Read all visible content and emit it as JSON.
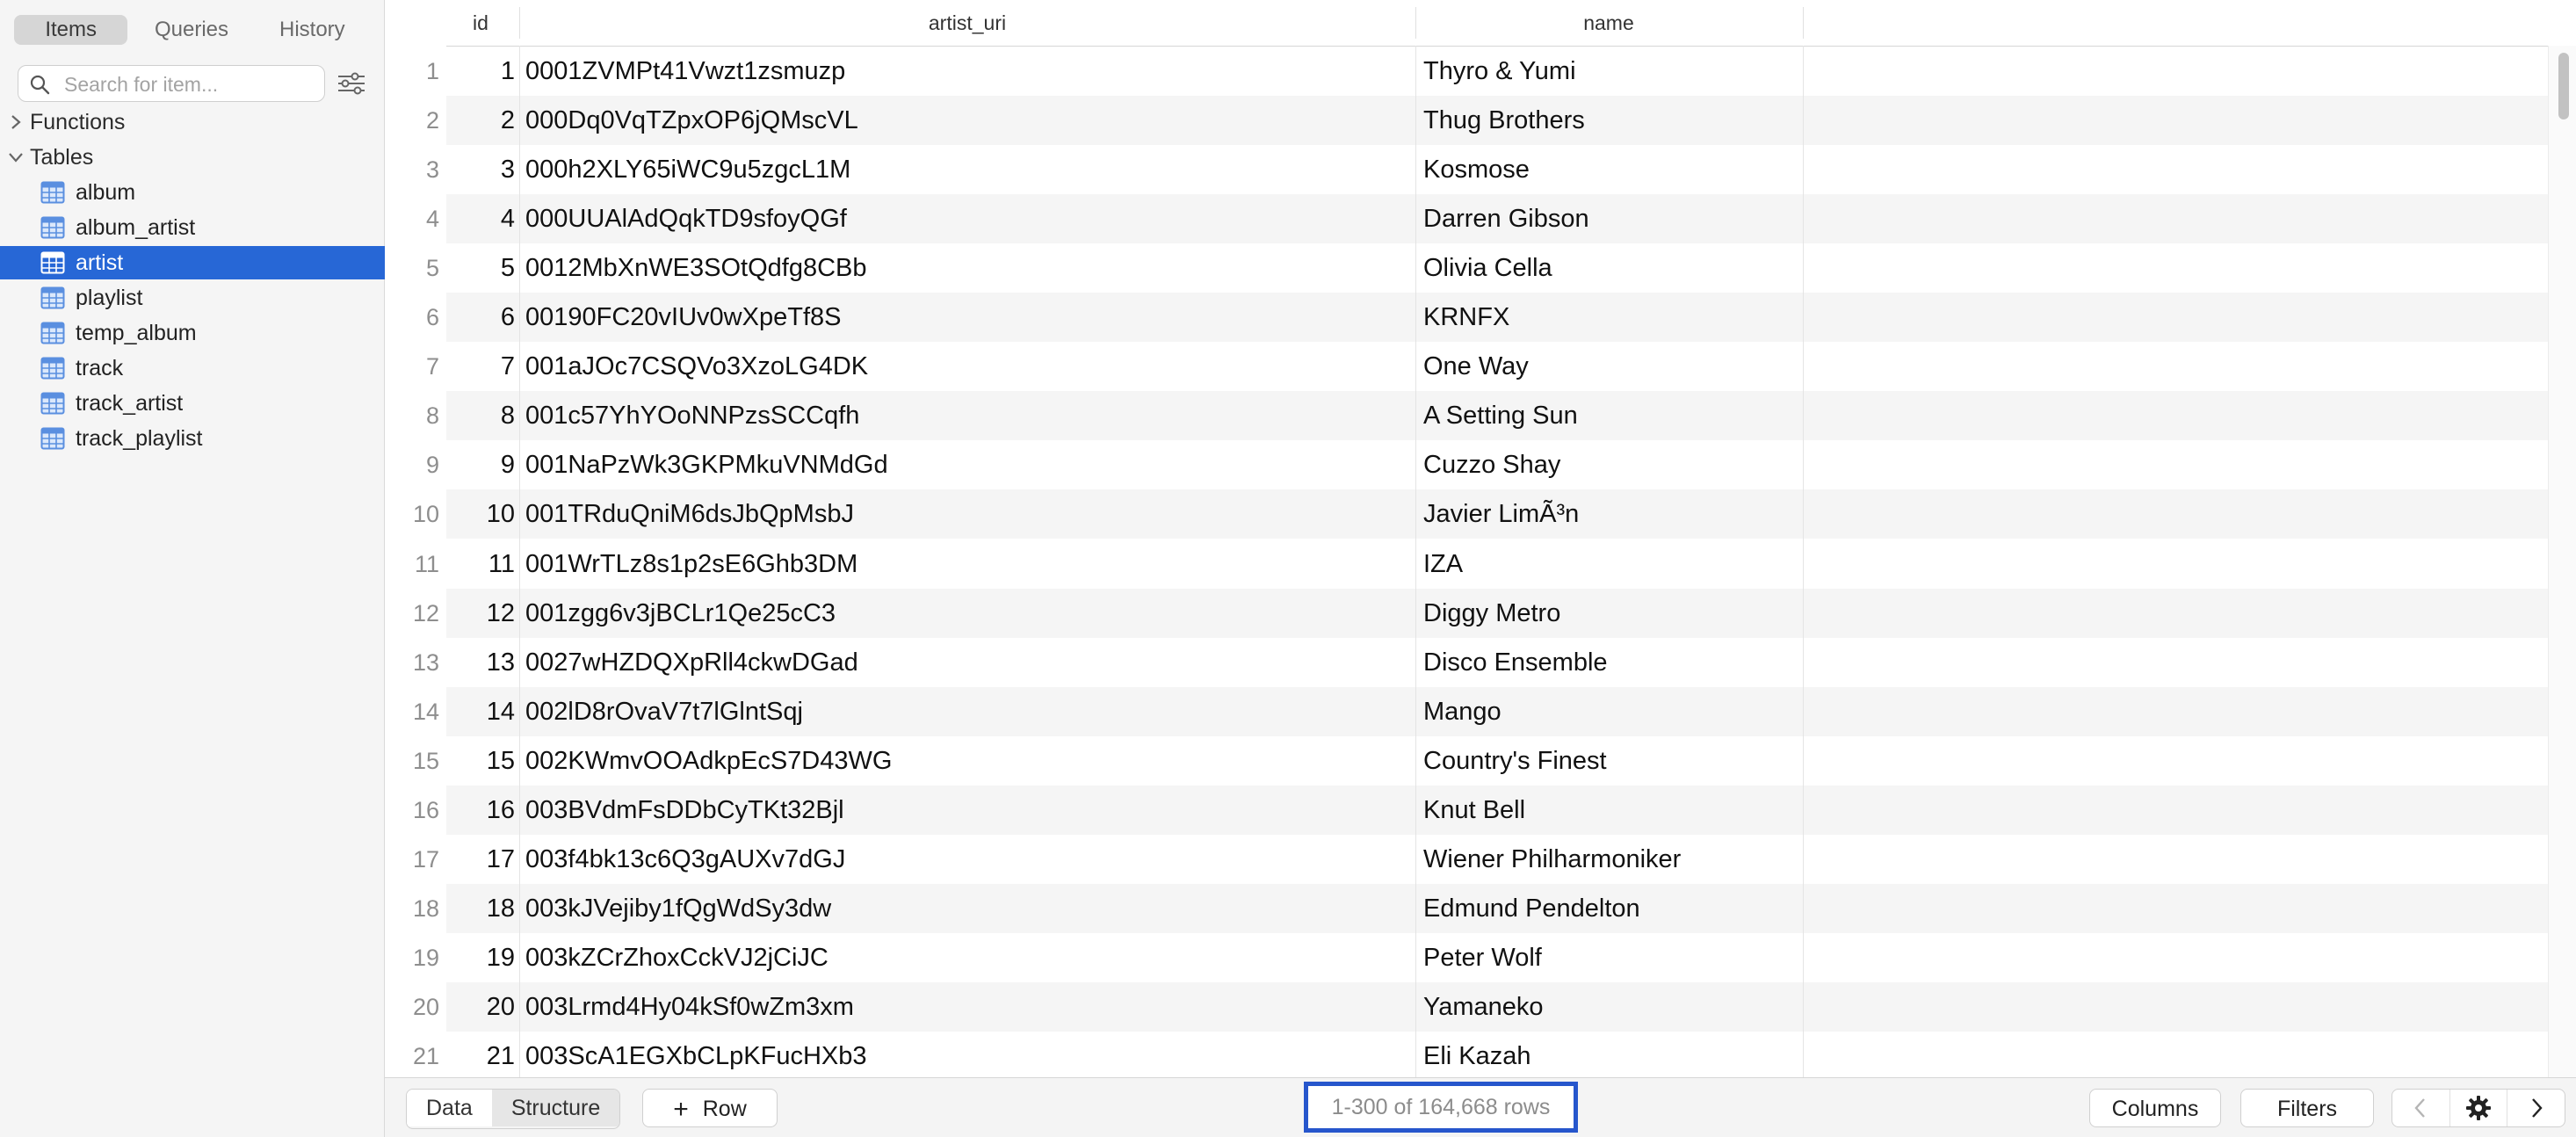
{
  "sidebar": {
    "tabs": [
      {
        "label": "Items",
        "active": true
      },
      {
        "label": "Queries",
        "active": false
      },
      {
        "label": "History",
        "active": false
      }
    ],
    "search": {
      "placeholder": "Search for item...",
      "value": ""
    },
    "groups": {
      "functions": "Functions",
      "tables": "Tables"
    },
    "tables": [
      "album",
      "album_artist",
      "artist",
      "playlist",
      "temp_album",
      "track",
      "track_artist",
      "track_playlist"
    ],
    "selected_table": "artist"
  },
  "grid": {
    "columns": {
      "id": "id",
      "artist_uri": "artist_uri",
      "name": "name"
    },
    "rows": [
      {
        "n": "1",
        "id": "1",
        "uri": "0001ZVMPt41Vwzt1zsmuzp",
        "name": "Thyro & Yumi"
      },
      {
        "n": "2",
        "id": "2",
        "uri": "000Dq0VqTZpxOP6jQMscVL",
        "name": "Thug Brothers"
      },
      {
        "n": "3",
        "id": "3",
        "uri": "000h2XLY65iWC9u5zgcL1M",
        "name": "Kosmose"
      },
      {
        "n": "4",
        "id": "4",
        "uri": "000UUAlAdQqkTD9sfoyQGf",
        "name": "Darren Gibson"
      },
      {
        "n": "5",
        "id": "5",
        "uri": "0012MbXnWE3SOtQdfg8CBb",
        "name": "Olivia Cella"
      },
      {
        "n": "6",
        "id": "6",
        "uri": "00190FC20vIUv0wXpeTf8S",
        "name": "KRNFX"
      },
      {
        "n": "7",
        "id": "7",
        "uri": "001aJOc7CSQVo3XzoLG4DK",
        "name": "One Way"
      },
      {
        "n": "8",
        "id": "8",
        "uri": "001c57YhYOoNNPzsSCCqfh",
        "name": "A Setting Sun"
      },
      {
        "n": "9",
        "id": "9",
        "uri": "001NaPzWk3GKPMkuVNMdGd",
        "name": "Cuzzo Shay"
      },
      {
        "n": "10",
        "id": "10",
        "uri": "001TRduQniM6dsJbQpMsbJ",
        "name": "Javier LimÃ³n"
      },
      {
        "n": "11",
        "id": "11",
        "uri": "001WrTLz8s1p2sE6Ghb3DM",
        "name": "IZA"
      },
      {
        "n": "12",
        "id": "12",
        "uri": "001zgg6v3jBCLr1Qe25cC3",
        "name": "Diggy Metro"
      },
      {
        "n": "13",
        "id": "13",
        "uri": "0027wHZDQXpRll4ckwDGad",
        "name": "Disco Ensemble"
      },
      {
        "n": "14",
        "id": "14",
        "uri": "002lD8rOvaV7t7lGlntSqj",
        "name": "Mango"
      },
      {
        "n": "15",
        "id": "15",
        "uri": "002KWmvOOAdkpEcS7D43WG",
        "name": "Country's Finest"
      },
      {
        "n": "16",
        "id": "16",
        "uri": "003BVdmFsDDbCyTKt32Bjl",
        "name": "Knut Bell"
      },
      {
        "n": "17",
        "id": "17",
        "uri": "003f4bk13c6Q3gAUXv7dGJ",
        "name": "Wiener Philharmoniker"
      },
      {
        "n": "18",
        "id": "18",
        "uri": "003kJVejiby1fQgWdSy3dw",
        "name": "Edmund Pendelton"
      },
      {
        "n": "19",
        "id": "19",
        "uri": "003kZCrZhoxCckVJ2jCiJC",
        "name": "Peter Wolf"
      },
      {
        "n": "20",
        "id": "20",
        "uri": "003Lrmd4Hy04kSf0wZm3xm",
        "name": "Yamaneko"
      },
      {
        "n": "21",
        "id": "21",
        "uri": "003ScA1EGXbCLpKFucHXb3",
        "name": "Eli Kazah"
      }
    ]
  },
  "bottombar": {
    "data_label": "Data",
    "structure_label": "Structure",
    "row_label": "Row",
    "row_count": "1-300 of 164,668 rows",
    "columns_label": "Columns",
    "filters_label": "Filters"
  },
  "colors": {
    "accent": "#2767d6",
    "highlight_border": "#2656cc",
    "table_icon": "#5a8fe0"
  }
}
